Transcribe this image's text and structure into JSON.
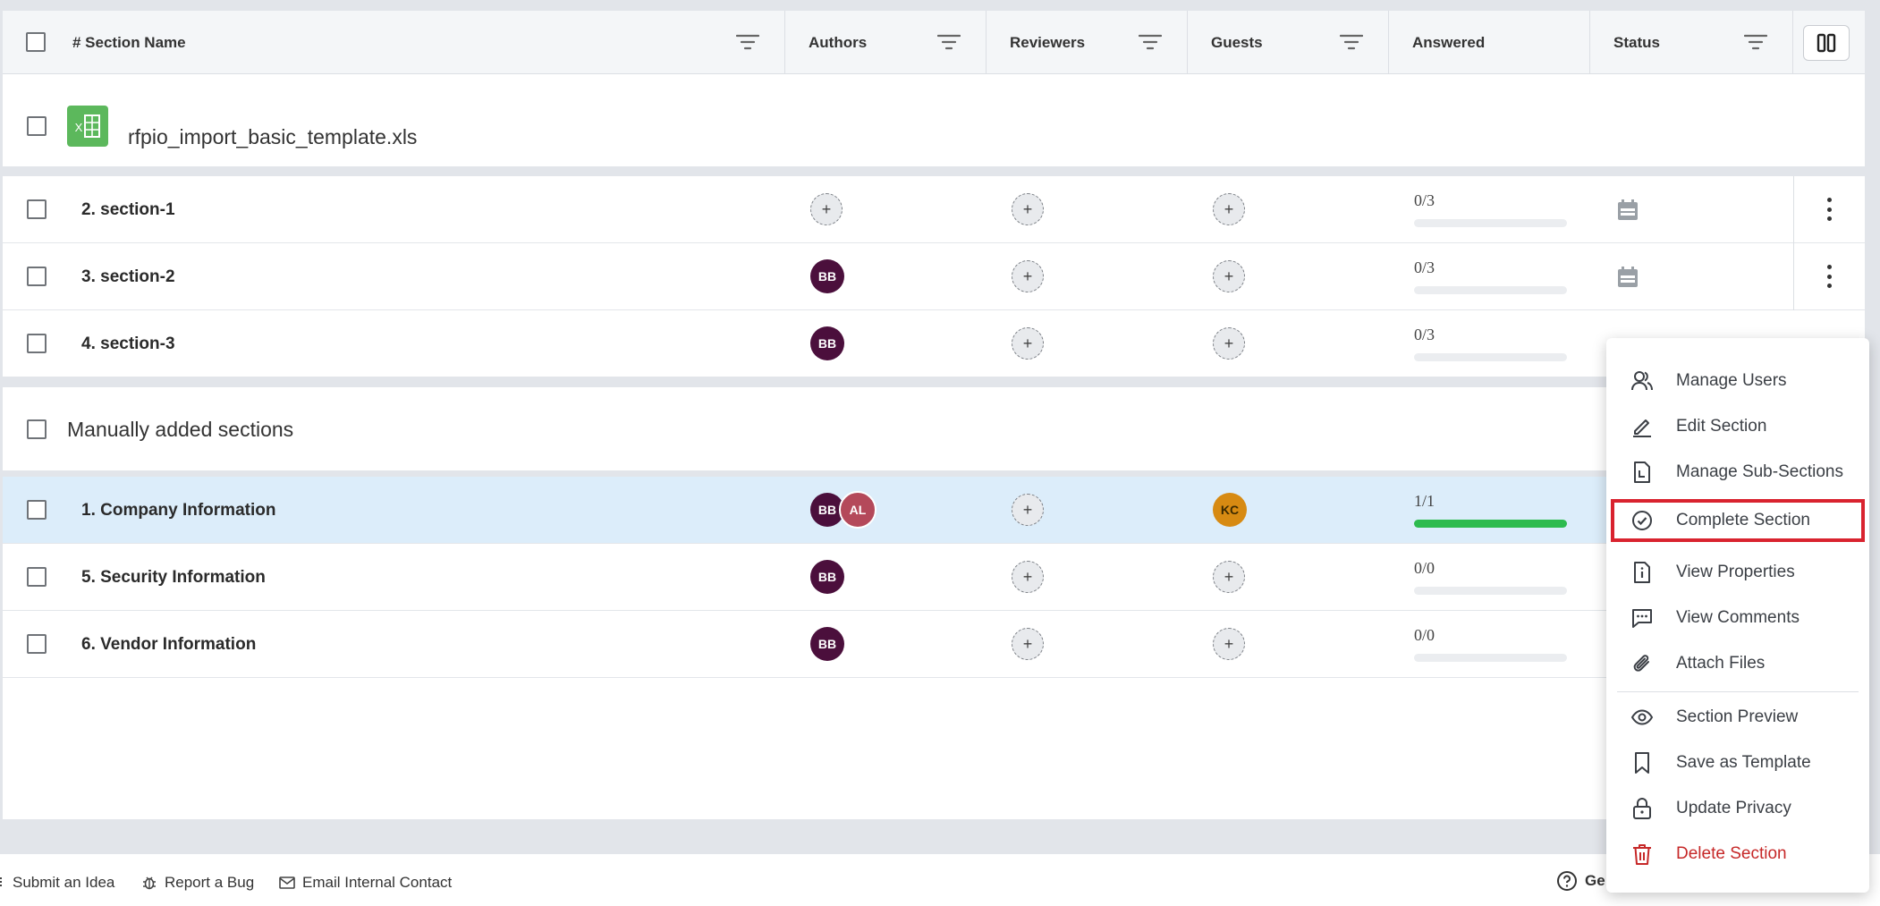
{
  "table": {
    "columns": {
      "name": "# Section Name",
      "authors": "Authors",
      "reviewers": "Reviewers",
      "guests": "Guests",
      "answered": "Answered",
      "status": "Status"
    },
    "groups": [
      {
        "title": "rfpio_import_basic_template.xls",
        "file_icon_label": "X",
        "rows": [
          {
            "name": "2. section-1",
            "authors": [],
            "reviewers": "+",
            "guests": "+",
            "answered": "0/3",
            "progress": 0
          },
          {
            "name": "3. section-2",
            "authors": [
              "BB"
            ],
            "reviewers": "+",
            "guests": "+",
            "answered": "0/3",
            "progress": 0
          },
          {
            "name": "4. section-3",
            "authors": [
              "BB"
            ],
            "reviewers": "+",
            "guests": "+",
            "answered": "0/3",
            "progress": 0
          }
        ]
      },
      {
        "title": "Manually added sections",
        "rows": [
          {
            "name": "1. Company Information",
            "authors": [
              "BB",
              "AL"
            ],
            "reviewers": "+",
            "guests": [
              "KC"
            ],
            "answered": "1/1",
            "progress": 1.0,
            "selected": true
          },
          {
            "name": "5. Security Information",
            "authors": [
              "BB"
            ],
            "reviewers": "+",
            "guests": "+",
            "answered": "0/0",
            "progress": 0
          },
          {
            "name": "6. Vendor Information",
            "authors": [
              "BB"
            ],
            "reviewers": "+",
            "guests": "+",
            "answered": "0/0",
            "progress": 0
          }
        ]
      }
    ],
    "add_symbol": "+"
  },
  "context_menu": {
    "items": [
      {
        "label": "Manage Users",
        "icon": "users-icon"
      },
      {
        "label": "Edit Section",
        "icon": "pencil-icon"
      },
      {
        "label": "Manage Sub-Sections",
        "icon": "subsection-icon"
      },
      {
        "label": "Complete Section",
        "icon": "check-circle-icon",
        "highlighted": true
      },
      {
        "label": "View Properties",
        "icon": "info-doc-icon"
      },
      {
        "label": "View Comments",
        "icon": "comment-icon"
      },
      {
        "label": "Attach Files",
        "icon": "paperclip-icon"
      },
      {
        "label": "Section Preview",
        "icon": "eye-icon"
      },
      {
        "label": "Save as Template",
        "icon": "bookmark-icon"
      },
      {
        "label": "Update Privacy",
        "icon": "lock-icon"
      },
      {
        "label": "Delete Section",
        "icon": "trash-icon",
        "danger": true
      }
    ]
  },
  "footer": {
    "submit_idea": "Submit an Idea",
    "report_bug": "Report a Bug",
    "email_contact": "Email Internal Contact",
    "help_partial": "Ge"
  },
  "colors": {
    "accent_red": "#d9232f",
    "progress_green": "#2dbb4e",
    "selected_row": "#dcedfa",
    "avatar_bb": "#4b0f3c",
    "avatar_al": "#b4495a",
    "avatar_kc": "#d78a12",
    "excel_green": "#5cb85c",
    "danger": "#c62828"
  }
}
